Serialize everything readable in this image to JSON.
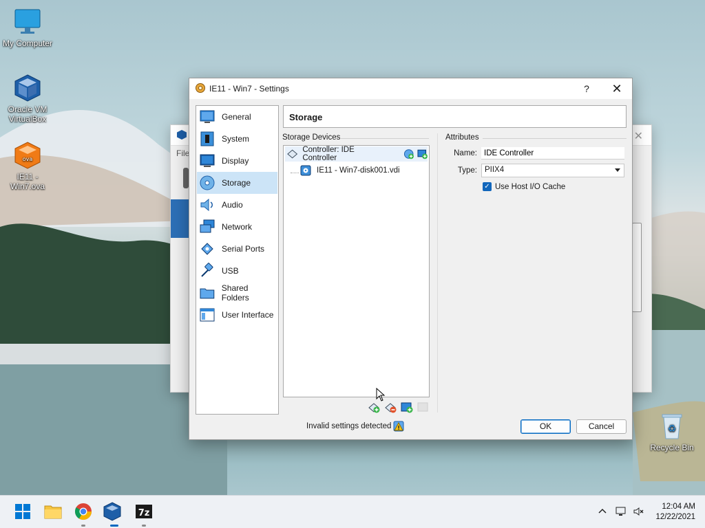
{
  "desktop": {
    "icons": [
      {
        "label": "My Computer"
      },
      {
        "label": "Oracle VM VirtualBox"
      },
      {
        "label": "IE11 - Win7.ova"
      },
      {
        "label": "Recycle Bin"
      }
    ]
  },
  "bg_window": {
    "menu_partial": "File"
  },
  "dialog": {
    "title": "IE11 - Win7 - Settings",
    "help_label": "?",
    "close_label": "✕",
    "sidebar": {
      "selected": "Storage",
      "items": [
        {
          "label": "General",
          "icon": "general-icon"
        },
        {
          "label": "System",
          "icon": "system-icon"
        },
        {
          "label": "Display",
          "icon": "display-icon"
        },
        {
          "label": "Storage",
          "icon": "storage-icon"
        },
        {
          "label": "Audio",
          "icon": "audio-icon"
        },
        {
          "label": "Network",
          "icon": "network-icon"
        },
        {
          "label": "Serial Ports",
          "icon": "serial-ports-icon"
        },
        {
          "label": "USB",
          "icon": "usb-icon"
        },
        {
          "label": "Shared Folders",
          "icon": "shared-folders-icon"
        },
        {
          "label": "User Interface",
          "icon": "user-interface-icon"
        }
      ]
    },
    "page_title": "Storage",
    "storage_devices": {
      "label": "Storage Devices",
      "controller": "Controller: IDE Controller",
      "disk": "IE11 - Win7-disk001.vdi"
    },
    "attributes": {
      "label": "Attributes",
      "name_label": "Name:",
      "name_value": "IDE Controller",
      "type_label": "Type:",
      "type_value": "PIIX4",
      "host_cache_label": "Use Host I/O Cache",
      "host_cache_checked": true
    },
    "status": "Invalid settings detected",
    "ok_label": "OK",
    "cancel_label": "Cancel"
  },
  "taskbar": {
    "time": "12:04 AM",
    "date": "12/22/2021"
  },
  "colors": {
    "accent": "#0067c0",
    "selection": "#cce4f7",
    "virtualbox_blue": "#2c6fb6"
  }
}
